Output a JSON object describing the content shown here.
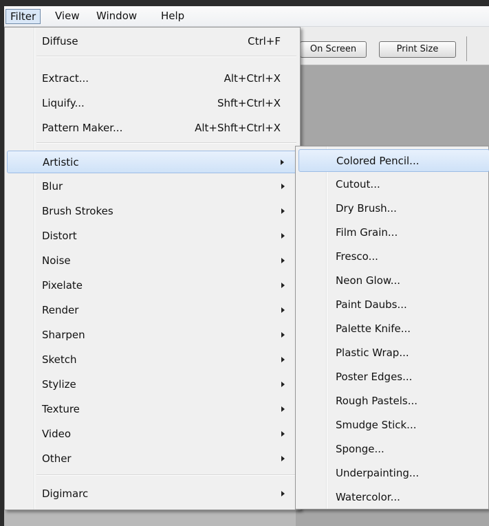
{
  "menubar": {
    "items": [
      {
        "label": "Filter"
      },
      {
        "label": "View"
      },
      {
        "label": "Window"
      },
      {
        "label": "Help"
      }
    ]
  },
  "toolbar": {
    "on_screen_label": "On Screen",
    "print_size_label": "Print Size"
  },
  "filter_menu": {
    "items": [
      {
        "label": "Diffuse",
        "shortcut": "Ctrl+F"
      },
      {
        "label": "Extract...",
        "shortcut": "Alt+Ctrl+X"
      },
      {
        "label": "Liquify...",
        "shortcut": "Shft+Ctrl+X"
      },
      {
        "label": "Pattern Maker...",
        "shortcut": "Alt+Shft+Ctrl+X"
      },
      {
        "label": "Artistic"
      },
      {
        "label": "Blur"
      },
      {
        "label": "Brush Strokes"
      },
      {
        "label": "Distort"
      },
      {
        "label": "Noise"
      },
      {
        "label": "Pixelate"
      },
      {
        "label": "Render"
      },
      {
        "label": "Sharpen"
      },
      {
        "label": "Sketch"
      },
      {
        "label": "Stylize"
      },
      {
        "label": "Texture"
      },
      {
        "label": "Video"
      },
      {
        "label": "Other"
      },
      {
        "label": "Digimarc"
      }
    ]
  },
  "artistic_submenu": {
    "items": [
      {
        "label": "Colored Pencil..."
      },
      {
        "label": "Cutout..."
      },
      {
        "label": "Dry Brush..."
      },
      {
        "label": "Film Grain..."
      },
      {
        "label": "Fresco..."
      },
      {
        "label": "Neon Glow..."
      },
      {
        "label": "Paint Daubs..."
      },
      {
        "label": "Palette Knife..."
      },
      {
        "label": "Plastic Wrap..."
      },
      {
        "label": "Poster Edges..."
      },
      {
        "label": "Rough Pastels..."
      },
      {
        "label": "Smudge Stick..."
      },
      {
        "label": "Sponge..."
      },
      {
        "label": "Underpainting..."
      },
      {
        "label": "Watercolor..."
      }
    ]
  }
}
